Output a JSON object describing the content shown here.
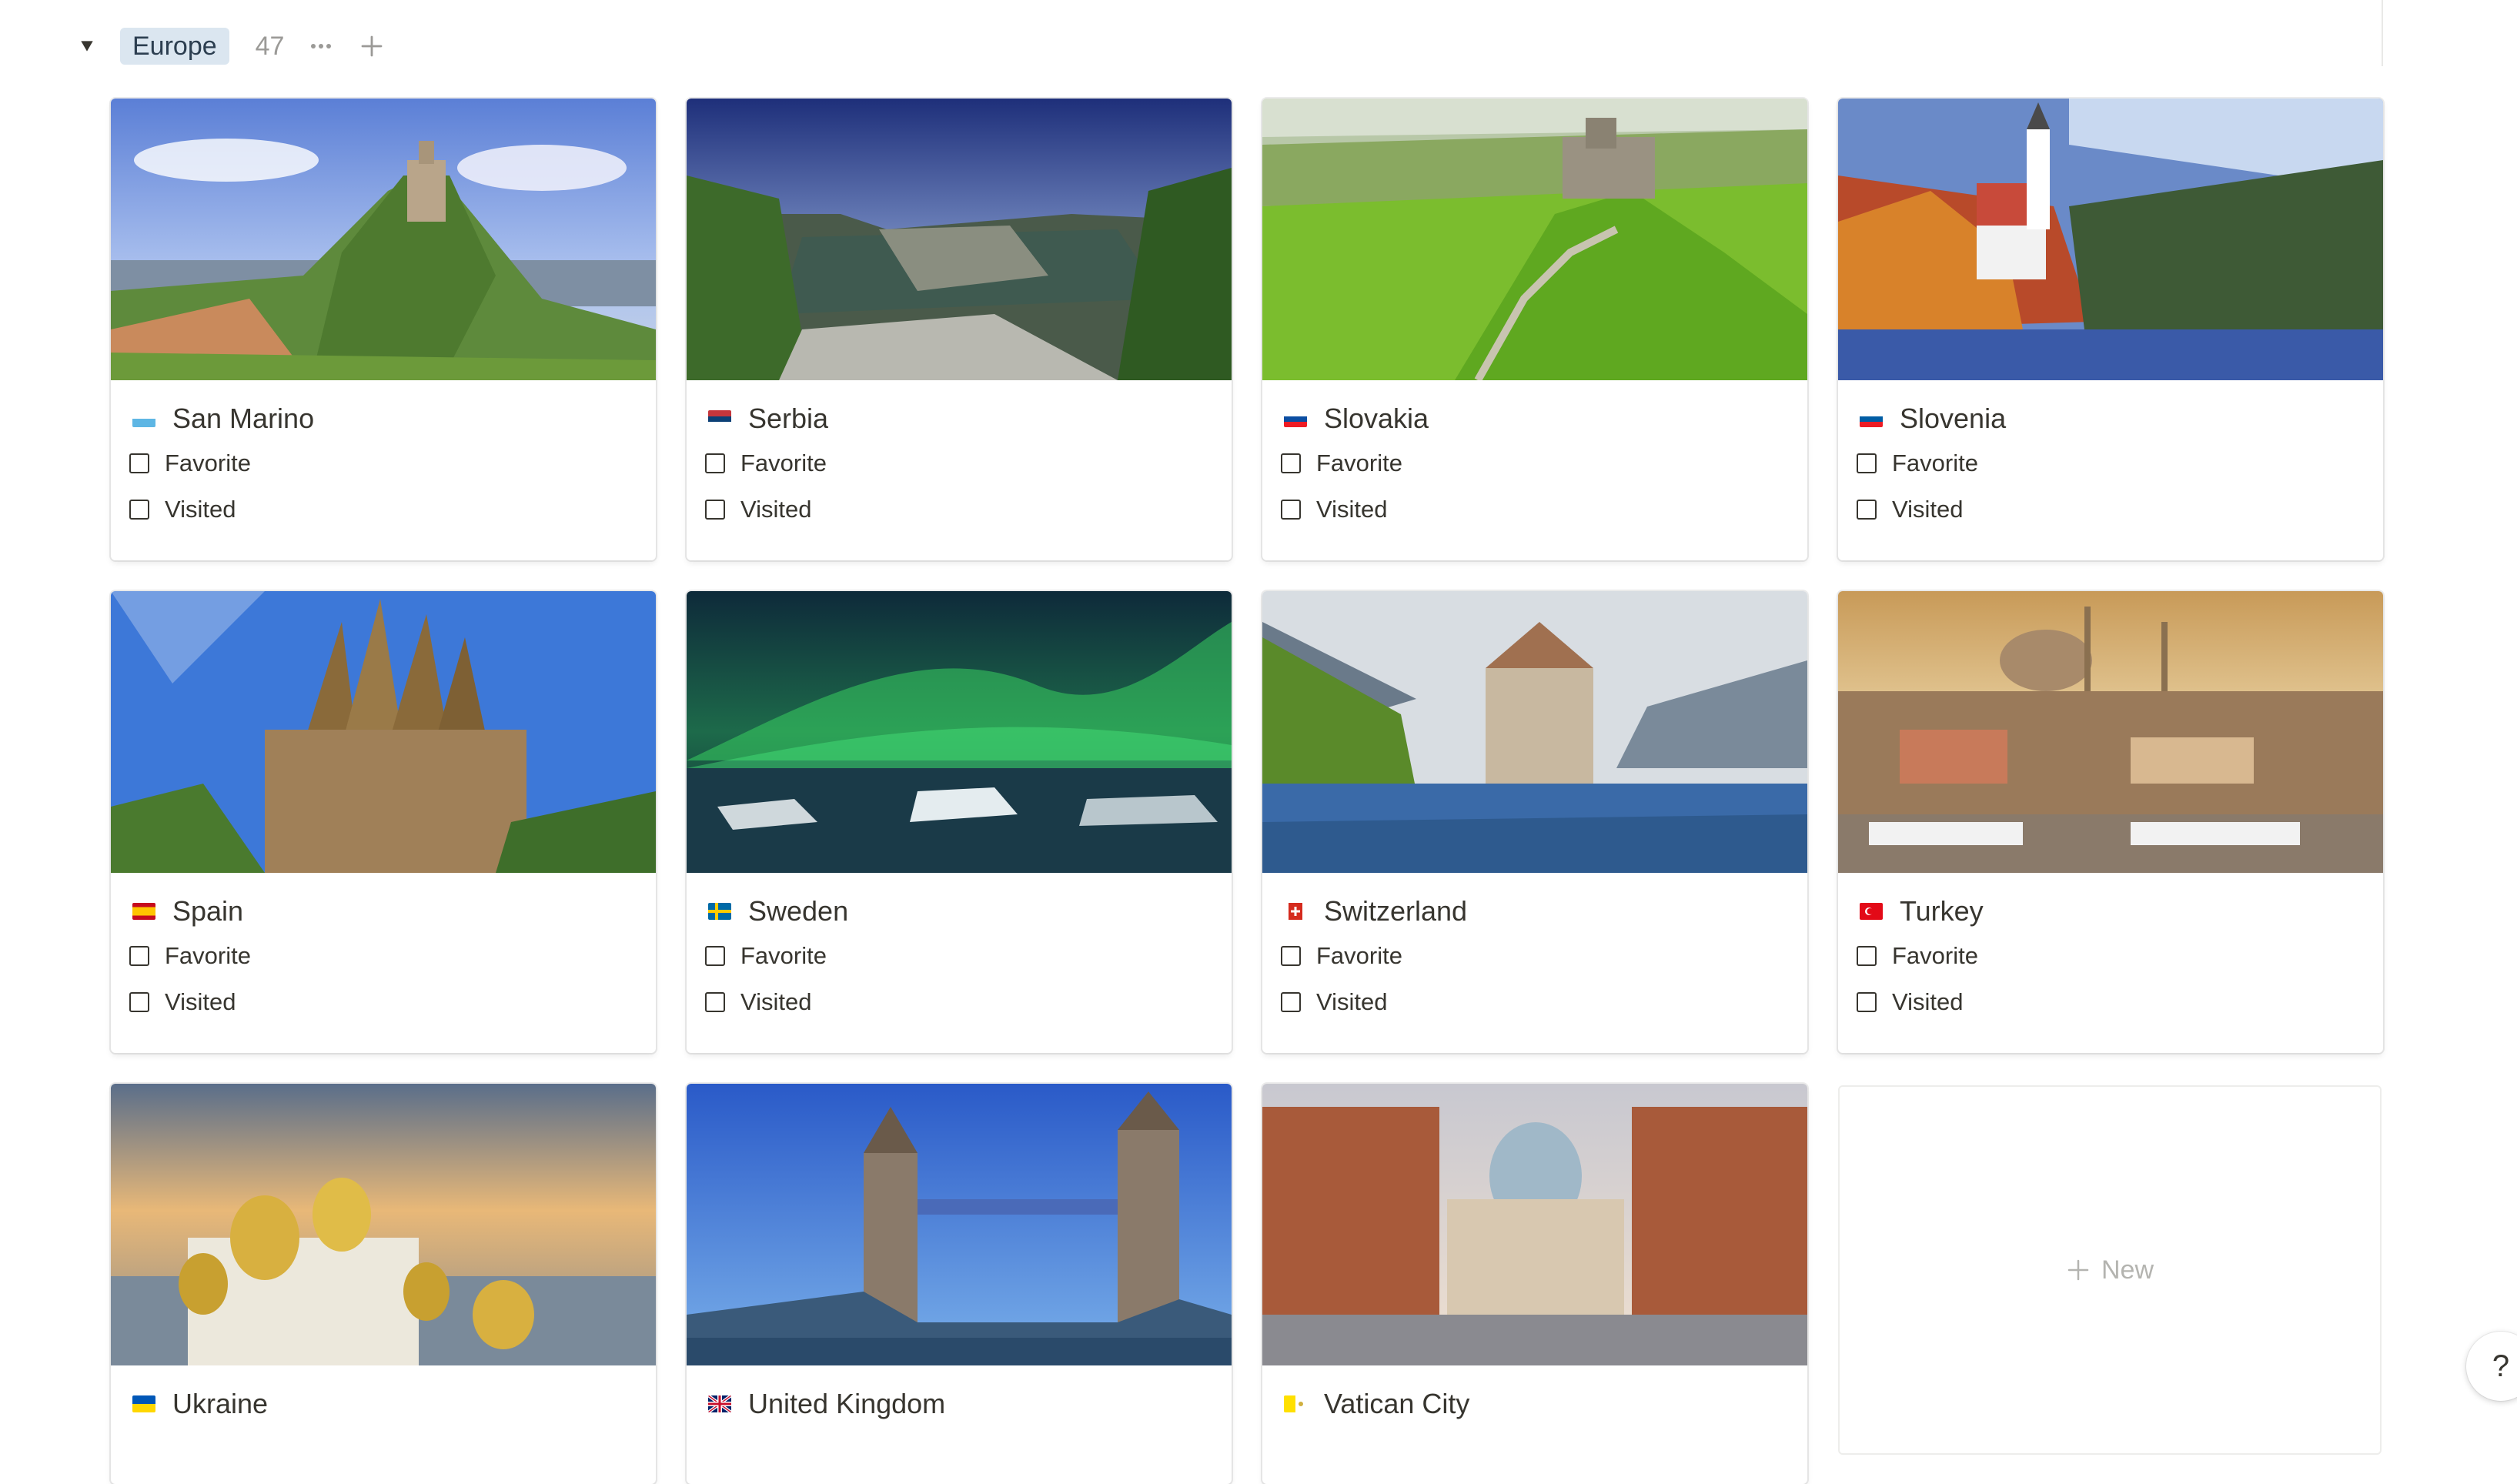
{
  "group": {
    "name": "Europe",
    "count": "47"
  },
  "cards": [
    {
      "name": "San Marino",
      "flag": "san-marino-flag-icon"
    },
    {
      "name": "Serbia",
      "flag": "serbia-flag-icon"
    },
    {
      "name": "Slovakia",
      "flag": "slovakia-flag-icon"
    },
    {
      "name": "Slovenia",
      "flag": "slovenia-flag-icon"
    },
    {
      "name": "Spain",
      "flag": "spain-flag-icon"
    },
    {
      "name": "Sweden",
      "flag": "sweden-flag-icon"
    },
    {
      "name": "Switzerland",
      "flag": "switzerland-flag-icon"
    },
    {
      "name": "Turkey",
      "flag": "turkey-flag-icon"
    },
    {
      "name": "Ukraine",
      "flag": "ukraine-flag-icon"
    },
    {
      "name": "United Kingdom",
      "flag": "united-kingdom-flag-icon"
    },
    {
      "name": "Vatican City",
      "flag": "vatican-city-flag-icon"
    }
  ],
  "properties": {
    "favorite": "Favorite",
    "visited": "Visited"
  },
  "new_card": {
    "label": "New"
  },
  "help": {
    "label": "?"
  },
  "colors": {
    "group_pill_bg": "#dbe6f0",
    "checkbox_border": "#37352f",
    "muted_text": "#9b9a97"
  }
}
